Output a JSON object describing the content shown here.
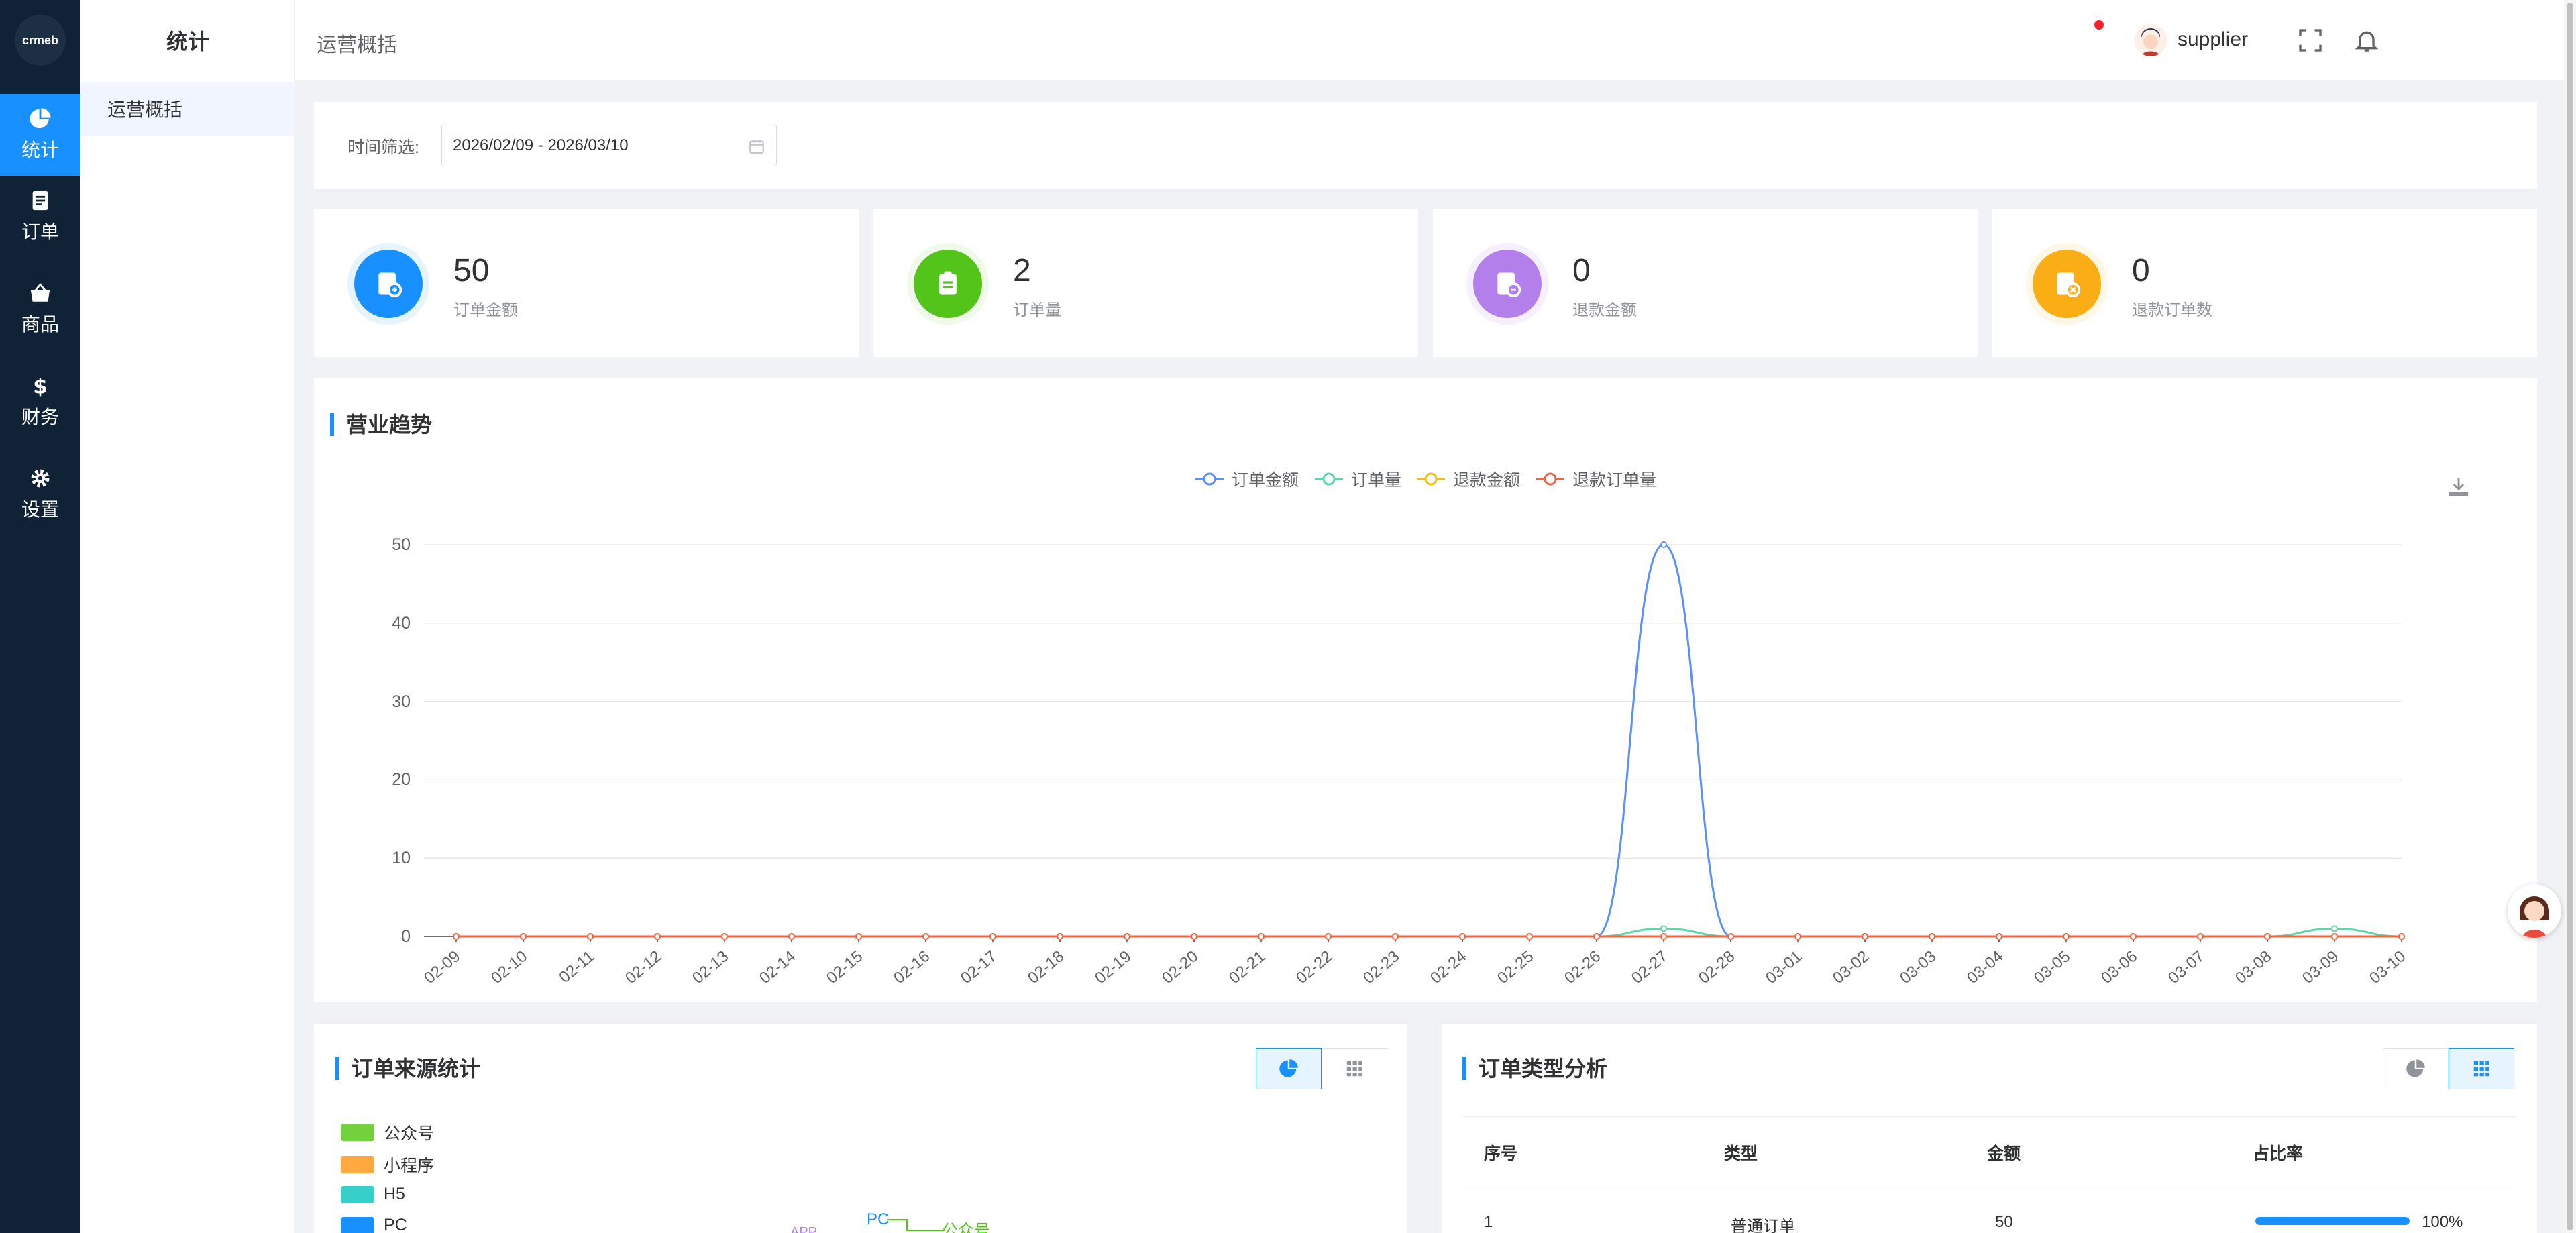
{
  "rail": {
    "logo_text": "crmeb",
    "items": [
      {
        "label": "统计",
        "icon": "pie-chart-icon",
        "active": true
      },
      {
        "label": "订单",
        "icon": "document-icon",
        "active": false
      },
      {
        "label": "商品",
        "icon": "basket-icon",
        "active": false
      },
      {
        "label": "财务",
        "icon": "dollar-icon",
        "active": false
      },
      {
        "label": "设置",
        "icon": "gear-icon",
        "active": false
      }
    ]
  },
  "submenu": {
    "title": "统计",
    "items": [
      {
        "label": "运营概括",
        "active": true
      }
    ]
  },
  "header": {
    "title": "运营概括",
    "username": "supplier",
    "icons": [
      "fullscreen-icon",
      "bell-icon",
      "avatar"
    ]
  },
  "filter": {
    "label": "时间筛选:",
    "value": "2026/02/09 - 2026/03/10"
  },
  "stats": [
    {
      "value": "50",
      "label": "订单金额",
      "color": "#1890ff"
    },
    {
      "value": "2",
      "label": "订单量",
      "color": "#52c41a"
    },
    {
      "value": "0",
      "label": "退款金额",
      "color": "#b37feb"
    },
    {
      "value": "0",
      "label": "退款订单数",
      "color": "#faad14"
    }
  ],
  "trend": {
    "title": "营业趋势"
  },
  "chart_data": {
    "type": "line",
    "title": "",
    "xlabel": "",
    "ylabel": "",
    "ylim": [
      0,
      50
    ],
    "yticks": [
      0,
      10,
      20,
      30,
      40,
      50
    ],
    "grid": true,
    "legend_position": "top-center",
    "x": [
      "02-09",
      "02-10",
      "02-11",
      "02-12",
      "02-13",
      "02-14",
      "02-15",
      "02-16",
      "02-17",
      "02-18",
      "02-19",
      "02-20",
      "02-21",
      "02-22",
      "02-23",
      "02-24",
      "02-25",
      "02-26",
      "02-27",
      "02-28",
      "03-01",
      "03-02",
      "03-03",
      "03-04",
      "03-05",
      "03-06",
      "03-07",
      "03-08",
      "03-09",
      "03-10"
    ],
    "series": [
      {
        "name": "订单金额",
        "color": "#5b8ff9",
        "values": [
          0,
          0,
          0,
          0,
          0,
          0,
          0,
          0,
          0,
          0,
          0,
          0,
          0,
          0,
          0,
          0,
          0,
          0,
          50,
          0,
          0,
          0,
          0,
          0,
          0,
          0,
          0,
          0,
          0,
          0
        ]
      },
      {
        "name": "订单量",
        "color": "#5ad8a6",
        "values": [
          0,
          0,
          0,
          0,
          0,
          0,
          0,
          0,
          0,
          0,
          0,
          0,
          0,
          0,
          0,
          0,
          0,
          0,
          1,
          0,
          0,
          0,
          0,
          0,
          0,
          0,
          0,
          0,
          1,
          0
        ]
      },
      {
        "name": "退款金额",
        "color": "#f6bd16",
        "values": [
          0,
          0,
          0,
          0,
          0,
          0,
          0,
          0,
          0,
          0,
          0,
          0,
          0,
          0,
          0,
          0,
          0,
          0,
          0,
          0,
          0,
          0,
          0,
          0,
          0,
          0,
          0,
          0,
          0,
          0
        ]
      },
      {
        "name": "退款订单量",
        "color": "#e8684a",
        "values": [
          0,
          0,
          0,
          0,
          0,
          0,
          0,
          0,
          0,
          0,
          0,
          0,
          0,
          0,
          0,
          0,
          0,
          0,
          0,
          0,
          0,
          0,
          0,
          0,
          0,
          0,
          0,
          0,
          0,
          0
        ]
      }
    ]
  },
  "source_panel": {
    "title": "订单来源统计",
    "legend": [
      {
        "name": "公众号",
        "color": "#73d13d"
      },
      {
        "name": "小程序",
        "color": "#ffa940"
      },
      {
        "name": "H5",
        "color": "#36cfc9"
      },
      {
        "name": "PC",
        "color": "#1890ff"
      }
    ],
    "pie_labels": {
      "pc": "PC",
      "gzh": "公众号",
      "app": "APP"
    }
  },
  "type_panel": {
    "title": "订单类型分析",
    "columns": [
      "序号",
      "类型",
      "金额",
      "占比率"
    ],
    "rows": [
      {
        "index": "1",
        "type": "普通订单",
        "amount": "50",
        "ratio_text": "100%",
        "ratio": 1.0
      }
    ]
  }
}
